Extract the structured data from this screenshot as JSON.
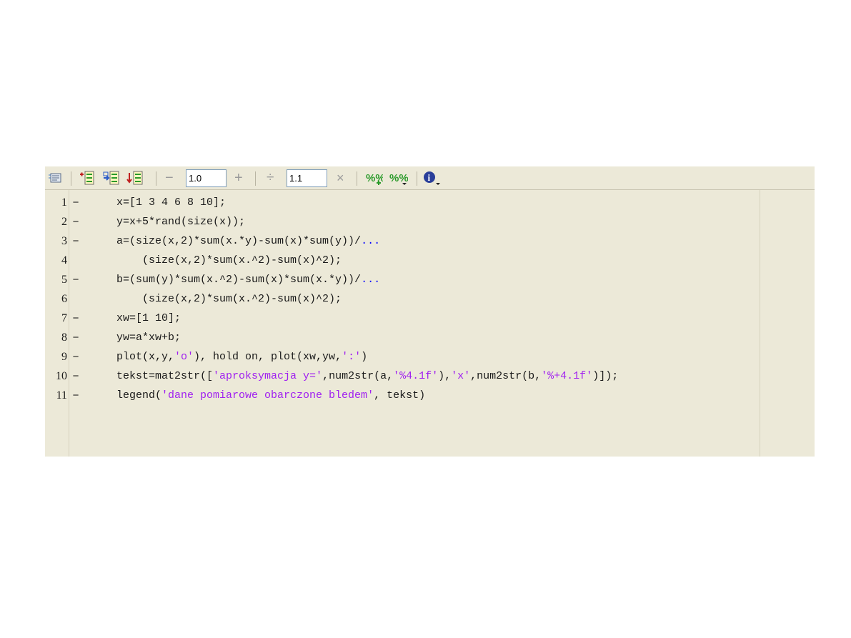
{
  "toolbar": {
    "icons": [
      "cell-mode-icon",
      "insert-cell-above-icon",
      "insert-cell-below-icon",
      "move-cell-down-icon",
      "minus-icon",
      "plus-icon",
      "divide-icon",
      "multiply-icon",
      "comment-icon",
      "uncomment-icon",
      "info-dropdown-icon"
    ],
    "decrement_label": "−",
    "increment_label": "+",
    "value_increment": "1.0",
    "divide_label": "÷",
    "multiply_label": "×",
    "value_scale": "1.1",
    "colors": {
      "toolbar_bg": "#ece9d8",
      "string": "#a020f0",
      "continuation": "#0000ff"
    }
  },
  "editor": {
    "lines": [
      {
        "num": "1",
        "marker": "−",
        "parts": [
          {
            "t": "x=[1 3 4 6 8 10];"
          }
        ]
      },
      {
        "num": "2",
        "marker": "−",
        "parts": [
          {
            "t": "y=x+5*rand(size(x));"
          }
        ]
      },
      {
        "num": "3",
        "marker": "−",
        "parts": [
          {
            "t": "a=(size(x,2)*sum(x.*y)-sum(x)*sum(y))/"
          },
          {
            "t": "...",
            "c": "cont"
          }
        ]
      },
      {
        "num": "4",
        "marker": "",
        "parts": [
          {
            "t": "    (size(x,2)*sum(x.^2)-sum(x)^2);"
          }
        ]
      },
      {
        "num": "5",
        "marker": "−",
        "parts": [
          {
            "t": "b=(sum(y)*sum(x.^2)-sum(x)*sum(x.*y))/"
          },
          {
            "t": "...",
            "c": "cont"
          }
        ]
      },
      {
        "num": "6",
        "marker": "",
        "parts": [
          {
            "t": "    (size(x,2)*sum(x.^2)-sum(x)^2);"
          }
        ]
      },
      {
        "num": "7",
        "marker": "−",
        "parts": [
          {
            "t": "xw=[1 10];"
          }
        ]
      },
      {
        "num": "8",
        "marker": "−",
        "parts": [
          {
            "t": "yw=a*xw+b;"
          }
        ]
      },
      {
        "num": "9",
        "marker": "−",
        "parts": [
          {
            "t": "plot(x,y,"
          },
          {
            "t": "'o'",
            "c": "str"
          },
          {
            "t": "), hold on, plot(xw,yw,"
          },
          {
            "t": "':'",
            "c": "str"
          },
          {
            "t": ")"
          }
        ]
      },
      {
        "num": "10",
        "marker": "−",
        "parts": [
          {
            "t": "tekst=mat2str(["
          },
          {
            "t": "'aproksymacja y='",
            "c": "str"
          },
          {
            "t": ",num2str(a,"
          },
          {
            "t": "'%4.1f'",
            "c": "str"
          },
          {
            "t": "),"
          },
          {
            "t": "'x'",
            "c": "str"
          },
          {
            "t": ",num2str(b,"
          },
          {
            "t": "'%+4.1f'",
            "c": "str"
          },
          {
            "t": ")]);"
          }
        ]
      },
      {
        "num": "11",
        "marker": "−",
        "parts": [
          {
            "t": "legend("
          },
          {
            "t": "'dane pomiarowe obarczone bledem'",
            "c": "str"
          },
          {
            "t": ", tekst)"
          }
        ]
      }
    ]
  }
}
